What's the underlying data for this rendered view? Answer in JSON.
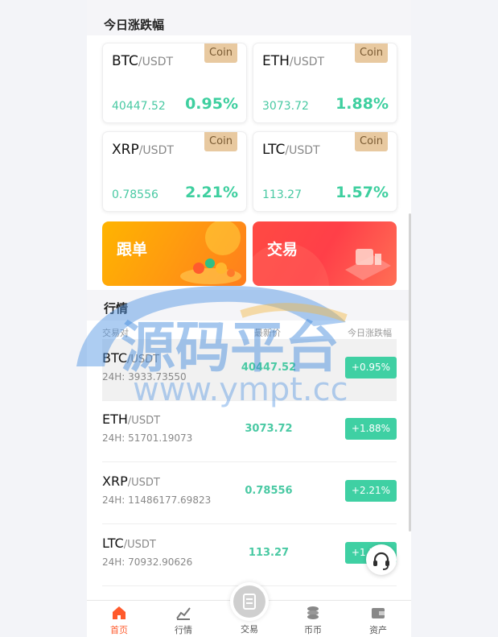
{
  "section_daily": {
    "title": "今日涨跌幅"
  },
  "cards": [
    {
      "base": "BTC",
      "quote": "/USDT",
      "badge": "Coin",
      "price": "40447.52",
      "pct": "0.95%"
    },
    {
      "base": "ETH",
      "quote": "/USDT",
      "badge": "Coin",
      "price": "3073.72",
      "pct": "1.88%"
    },
    {
      "base": "XRP",
      "quote": "/USDT",
      "badge": "Coin",
      "price": "0.78556",
      "pct": "2.21%"
    },
    {
      "base": "LTC",
      "quote": "/USDT",
      "badge": "Coin",
      "price": "113.27",
      "pct": "1.57%"
    }
  ],
  "banners": {
    "follow": "跟单",
    "trade": "交易"
  },
  "section_market": {
    "title": "行情"
  },
  "market_headers": {
    "pair": "交易对",
    "last": "最新价",
    "change": "今日涨跌幅"
  },
  "market_rows": [
    {
      "base": "BTC",
      "quote": "/USDT",
      "volume": "24H: 3933.73550",
      "last": "40447.52",
      "change": "+0.95%"
    },
    {
      "base": "ETH",
      "quote": "/USDT",
      "volume": "24H: 51701.19073",
      "last": "3073.72",
      "change": "+1.88%"
    },
    {
      "base": "XRP",
      "quote": "/USDT",
      "volume": "24H: 11486177.69823",
      "last": "0.78556",
      "change": "+2.21%"
    },
    {
      "base": "LTC",
      "quote": "/USDT",
      "volume": "24H: 70932.90626",
      "last": "113.27",
      "change": "+1.57%"
    }
  ],
  "tabbar": {
    "home": "首页",
    "market": "行情",
    "trade": "交易",
    "coins": "币币",
    "assets": "资产"
  },
  "watermark": {
    "cn": "源码平台",
    "url": "www.ympt.cc"
  },
  "colors": {
    "accent": "#ff5a2c",
    "up": "#3fd0a3",
    "badge": "#e8c9a0"
  },
  "icons": [
    "home-icon",
    "market-chart-icon",
    "trade-wallet-icon",
    "coins-icon",
    "assets-wallet-icon",
    "headset-icon"
  ]
}
